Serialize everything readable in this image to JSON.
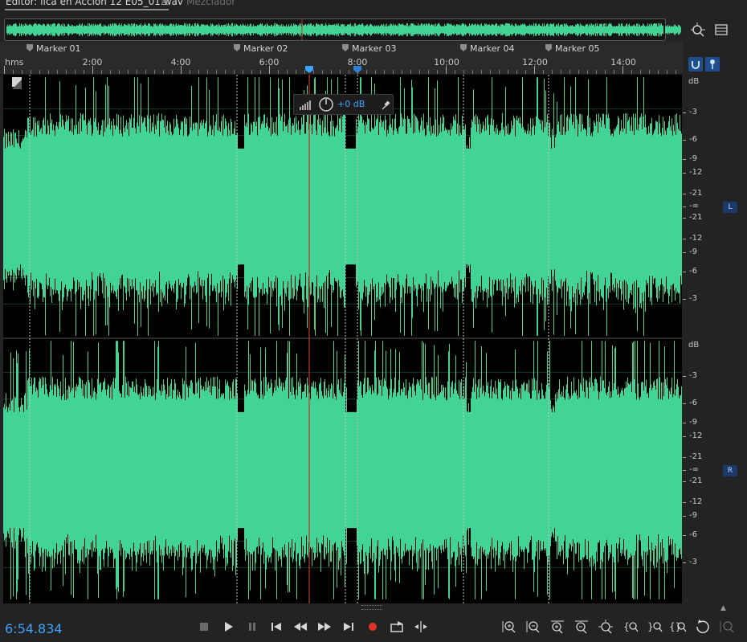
{
  "tabs": {
    "editor_label": "Editor: lica en Accion 12 E05_01.wav",
    "mixer_label": "Mezclador"
  },
  "overview_buttons": {
    "zoom_full_icon": "zoom-full-icon",
    "panel_menu_icon": "panel-menu-icon"
  },
  "ruler": {
    "units_label": "hms",
    "ticks": [
      "2:00",
      "4:00",
      "6:00",
      "8:00",
      "10:00",
      "12:00",
      "14:00"
    ],
    "markers": [
      "Marker 01",
      "Marker 02",
      "Marker 03",
      "Marker 04",
      "Marker 05"
    ],
    "snap_icon": "magnet-icon",
    "pin_icon": "pin-icon"
  },
  "hud": {
    "value": "+0 dB"
  },
  "db_scale": {
    "unit": "dB",
    "labels": [
      "-3",
      "-6",
      "-9",
      "-12",
      "-21",
      "-∞",
      "-21",
      "-12",
      "-9",
      "-6",
      "-3"
    ]
  },
  "channels": {
    "left": "L",
    "right": "R"
  },
  "transport": {
    "current_time": "6:54.834"
  },
  "colors": {
    "waveform": "#41d494",
    "playhead": "#c0392b",
    "accent": "#3ea3ff"
  }
}
